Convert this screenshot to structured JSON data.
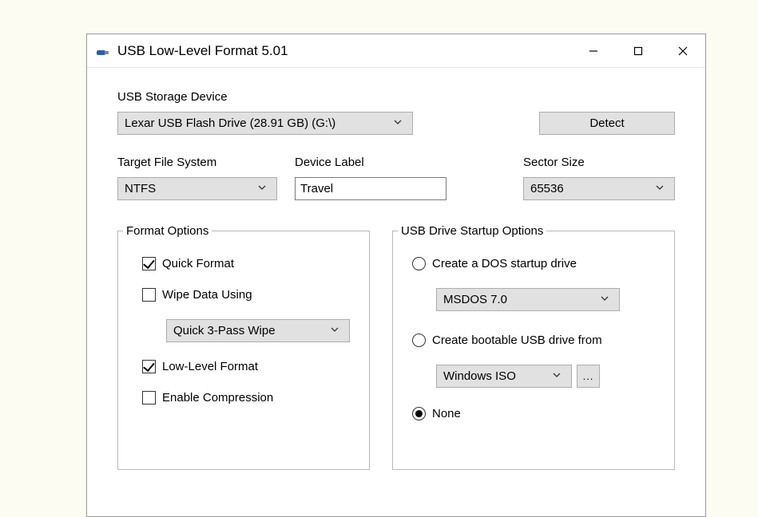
{
  "window": {
    "title": "USB Low-Level Format 5.01"
  },
  "labels": {
    "usb_storage": "USB Storage Device",
    "target_fs": "Target File System",
    "device_label": "Device Label",
    "sector_size": "Sector Size",
    "detect": "Detect"
  },
  "device": {
    "selected": "Lexar USB Flash Drive (28.91 GB) (G:\\)"
  },
  "fs": {
    "selected": "NTFS"
  },
  "devlabel": {
    "value": "Travel"
  },
  "sector": {
    "selected": "65536"
  },
  "format_options": {
    "legend": "Format Options",
    "quick_format": "Quick Format",
    "wipe_data": "Wipe Data Using",
    "wipe_method": "Quick 3-Pass Wipe",
    "low_level": "Low-Level Format",
    "compression": "Enable Compression"
  },
  "startup_options": {
    "legend": "USB Drive Startup Options",
    "dos": "Create a DOS startup drive",
    "dos_ver": "MSDOS 7.0",
    "bootable": "Create bootable USB drive from",
    "iso": "Windows ISO",
    "browse": "...",
    "none": "None"
  }
}
